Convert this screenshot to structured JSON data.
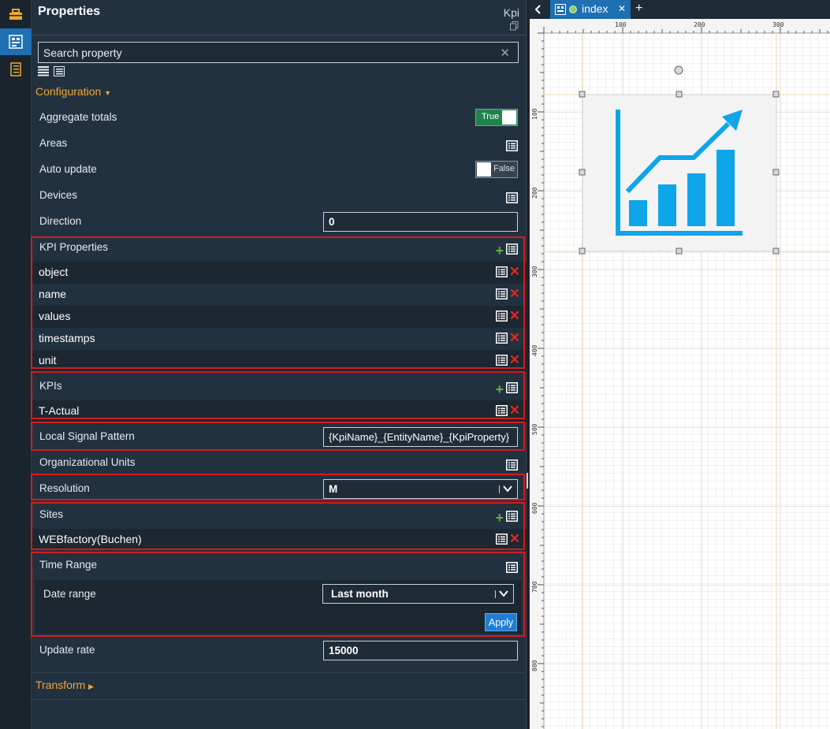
{
  "panel": {
    "title": "Properties",
    "context": "Kpi",
    "search_placeholder": "Search property",
    "configuration_label": "Configuration",
    "transform_label": "Transform"
  },
  "props": {
    "aggregate_totals": {
      "label": "Aggregate totals",
      "toggle": "True"
    },
    "areas": {
      "label": "Areas"
    },
    "auto_update": {
      "label": "Auto update",
      "toggle": "False"
    },
    "devices": {
      "label": "Devices"
    },
    "direction": {
      "label": "Direction",
      "value": "0"
    },
    "kpi_properties": {
      "label": "KPI Properties",
      "items": [
        "object",
        "name",
        "values",
        "timestamps",
        "unit"
      ]
    },
    "kpis": {
      "label": "KPIs",
      "items": [
        "T-Actual"
      ]
    },
    "local_signal_pattern": {
      "label": "Local Signal Pattern",
      "value": "{KpiName}_{EntityName}_{KpiProperty}"
    },
    "organizational_units": {
      "label": "Organizational Units"
    },
    "resolution": {
      "label": "Resolution",
      "value": "M"
    },
    "sites": {
      "label": "Sites",
      "items": [
        "WEBfactory(Buchen)"
      ]
    },
    "time_range": {
      "label": "Time Range",
      "date_range_label": "Date range",
      "date_range_value": "Last month",
      "apply_label": "Apply"
    },
    "update_rate": {
      "label": "Update rate",
      "value": "15000"
    }
  },
  "tabs": {
    "active": "index"
  },
  "ruler": {
    "top": [
      "100",
      "200",
      "300"
    ],
    "left": [
      "100",
      "200",
      "300",
      "400",
      "500",
      "600",
      "700",
      "800"
    ]
  },
  "colors": {
    "accent": "#f0a830",
    "highlight": "#d41c1c",
    "toggle_on": "#1e8449",
    "tab_active": "#1f6fb3",
    "kpi_icon": "#0ea5e9"
  }
}
